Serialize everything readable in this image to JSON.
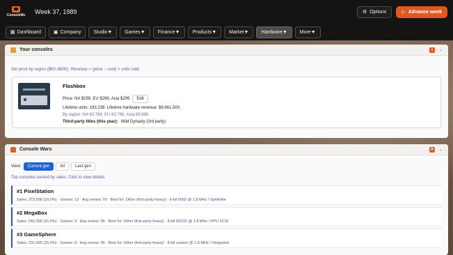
{
  "app": {
    "logo_text": "ConsoleMe",
    "week": "Week 37, 1989"
  },
  "topbar": {
    "options_label": "Options",
    "advance_label": "Advance week"
  },
  "nav": [
    {
      "label": "Dashboard",
      "icon": "dashboard-icon"
    },
    {
      "label": "Company",
      "icon": "building-icon"
    },
    {
      "label": "Studio▼"
    },
    {
      "label": "Games▼"
    },
    {
      "label": "Finance▼"
    },
    {
      "label": "Products▼"
    },
    {
      "label": "Market▼"
    },
    {
      "label": "Hardware▼",
      "active": true
    },
    {
      "label": "More▼"
    }
  ],
  "consoles_panel": {
    "title": "Your consoles",
    "count": "1",
    "note": "Set price by region ($50–$600). Revenue = (price − cost) × units sold.",
    "console": {
      "name": "Flashbox",
      "price_line": "Price: NA $299, EU $299, Asia $299",
      "edit_label": "Edit",
      "lifetime_line": "Lifetime units: 193,238. Lifetime hardware revenue: $9,661,500.",
      "region_line": "By region: NA 63,766, EU 63,766, Asia 65,698",
      "third_party_label": "Third-party titles (this year):",
      "third_party_value": "Wild Dynasty (3rd party)"
    }
  },
  "wars_panel": {
    "title": "Console Wars",
    "view_label": "View:",
    "views": [
      "Current gen",
      "All",
      "Last gen"
    ],
    "note": "Top consoles ranked by sales. Click to view details.",
    "rankings": [
      {
        "title": "#1 PixelStation",
        "detail": "Sales: 273,558 (18.0%) · Games: 13 · Avg review: 93 · Best for: Other (first-party heavy) · 8-bit 6502 @ 1.8 MHz / Sprite/tile"
      },
      {
        "title": "#2 MegaBox",
        "detail": "Sales: 242,396 (15.6%) · Games: 9 · Avg review: 96 · Best for: Other (first-party heavy) · 8-bit 65C02 @ 1.8 MHz / PPU 2C02"
      },
      {
        "title": "#3 GameSphere",
        "detail": "Sales: 231,065 (15.0%) · Games: 8 · Avg review: 96 · Best for: Other (first-party heavy) · 8-bit custom @ 1.8 MHz / Integrated"
      }
    ]
  }
}
